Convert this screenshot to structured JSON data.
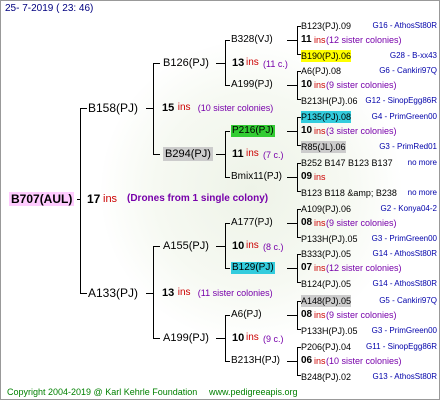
{
  "header": {
    "date": "25-  7-2019 ( 23: 46)"
  },
  "root": {
    "label": "B707(AUL)",
    "num": "17",
    "ins": "ins",
    "note": "(Drones from 1 single colony)",
    "color": "#ffccff"
  },
  "l1": [
    {
      "label": "B158(PJ)",
      "num": "15",
      "ins": "ins",
      "note": "(10 sister colonies)"
    },
    {
      "label": "A133(PJ)",
      "num": "13",
      "ins": "ins",
      "note": "(11 sister colonies)"
    }
  ],
  "l2": [
    {
      "label": "B126(PJ)",
      "num": "13",
      "ins": "ins",
      "note": "(11 c.)"
    },
    {
      "label": "B294(PJ)",
      "num": "11",
      "ins": "ins",
      "note": "(7 c.)",
      "color": "#cccccc"
    },
    {
      "label": "A155(PJ)",
      "num": "10",
      "ins": "ins",
      "note": "(8 c.)"
    },
    {
      "label": "A199(PJ)",
      "num": "10",
      "ins": "ins",
      "note": "(9 c.)"
    }
  ],
  "l3": [
    {
      "label": "B328(VJ)"
    },
    {
      "label": "A199(PJ)"
    },
    {
      "label": "P216(PJ)",
      "color": "#33cc33"
    },
    {
      "label": "Bmix11(PJ)"
    },
    {
      "label": "A177(PJ)"
    },
    {
      "label": "B129(PJ)",
      "color": "#33ccdd"
    },
    {
      "label": "A6(PJ)"
    },
    {
      "label": "B213H(PJ)"
    }
  ],
  "l4": [
    {
      "top": "B123(PJ).09",
      "topr": "G16 - AthosSt80R",
      "num": "11",
      "note": "(12 sister colonies)",
      "bot": "B190(PJ).06",
      "botr": "G28 - B-xx43",
      "botcolor": "#ffff00"
    },
    {
      "top": "A6(PJ).08",
      "topr": "G6 - Cankiri97Q",
      "num": "10",
      "note": "(9 sister colonies)",
      "bot": "B213H(PJ).06",
      "botr": "G12 - SinopEgg86R"
    },
    {
      "top": "P135(PJ).08",
      "topr": "G4 - PrimGreen00",
      "topcolor": "#33ccdd",
      "num": "10",
      "note": "(3 sister colonies)",
      "bot": "R85(JL).06",
      "botr": "G3 - PrimRed01",
      "botcolor": "#cccccc"
    },
    {
      "top": "B252 B147 B123 B137",
      "topr": "no more",
      "num": "09",
      "note": "",
      "bot": "B123 B118 &amp; B238",
      "botr": "no more"
    },
    {
      "top": "A109(PJ).06",
      "topr": "G2 - Konya04-2",
      "num": "08",
      "note": "(9 sister colonies)",
      "bot": "P133H(PJ).05",
      "botr": "G3 - PrimGreen00"
    },
    {
      "top": "B333(PJ).05",
      "topr": "G14 - AthosSt80R",
      "num": "07",
      "note": "(12 sister colonies)",
      "bot": "B124(PJ).05",
      "botr": "G14 - AthosSt80R"
    },
    {
      "top": "A148(PJ).05",
      "topr": "G5 - Cankiri97Q",
      "topcolor": "#cccccc",
      "num": "08",
      "note": "(9 sister colonies)",
      "bot": "P133H(PJ).05",
      "botr": "G3 - PrimGreen00"
    },
    {
      "top": "P206(PJ).04",
      "topr": "G11 - SinopEgg86R",
      "num": "06",
      "note": "(10 sister colonies)",
      "bot": "B248(PJ).02",
      "botr": "G13 - AthosSt80R"
    }
  ],
  "footer": {
    "copyright": "Copyright 2004-2019 @ Karl Kehrle Foundation",
    "site": "www.pedigreeapis.org"
  }
}
